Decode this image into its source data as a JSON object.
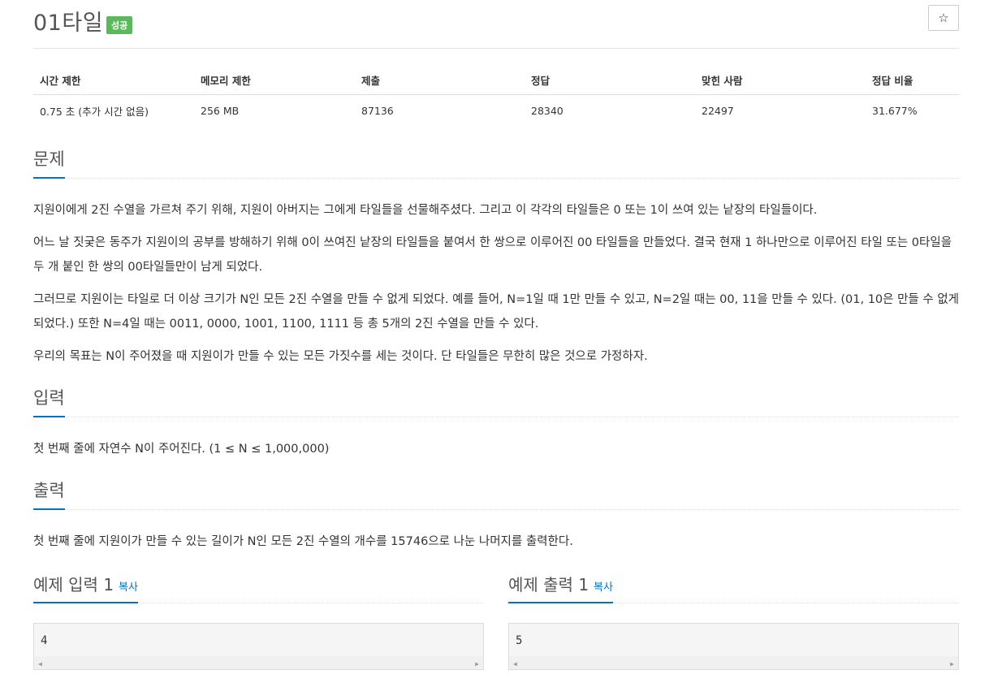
{
  "problem": {
    "title": "01타일",
    "badge": "성공",
    "star_icon": "☆"
  },
  "info_table": {
    "headers": [
      "시간 제한",
      "메모리 제한",
      "제출",
      "정답",
      "맞힌 사람",
      "정답 비율"
    ],
    "values": [
      "0.75 초 (추가 시간 없음)",
      "256 MB",
      "87136",
      "28340",
      "22497",
      "31.677%"
    ]
  },
  "sections": {
    "description_title": "문제",
    "description": [
      "지원이에게 2진 수열을 가르쳐 주기 위해, 지원이 아버지는 그에게 타일들을 선물해주셨다. 그리고 이 각각의 타일들은 0 또는 1이 쓰여 있는 낱장의 타일들이다.",
      "어느 날 짓궂은 동주가 지원이의 공부를 방해하기 위해 0이 쓰여진 낱장의 타일들을 붙여서 한 쌍으로 이루어진 00 타일들을 만들었다. 결국 현재 1 하나만으로 이루어진 타일 또는 0타일을 두 개 붙인 한 쌍의 00타일들만이 남게 되었다.",
      "그러므로 지원이는 타일로 더 이상 크기가 N인 모든 2진 수열을 만들 수 없게 되었다. 예를 들어, N=1일 때 1만 만들 수 있고, N=2일 때는 00, 11을 만들 수 있다. (01, 10은 만들 수 없게 되었다.) 또한 N=4일 때는 0011, 0000, 1001, 1100, 1111 등 총 5개의 2진 수열을 만들 수 있다.",
      "우리의 목표는 N이 주어졌을 때 지원이가 만들 수 있는 모든 가짓수를 세는 것이다. 단 타일들은 무한히 많은 것으로 가정하자."
    ],
    "input_title": "입력",
    "input": "첫 번째 줄에 자연수 N이 주어진다. (1 ≤ N ≤ 1,000,000)",
    "output_title": "출력",
    "output": "첫 번째 줄에 지원이가 만들 수 있는 길이가 N인 모든 2진 수열의 개수를 15746으로 나눈 나머지를 출력한다."
  },
  "examples": {
    "input_title": "예제 입력 1",
    "output_title": "예제 출력 1",
    "copy_label": "복사",
    "input_value": "4",
    "output_value": "5"
  },
  "colors": {
    "accent": "#0076c0",
    "badge": "#5cb85c"
  }
}
